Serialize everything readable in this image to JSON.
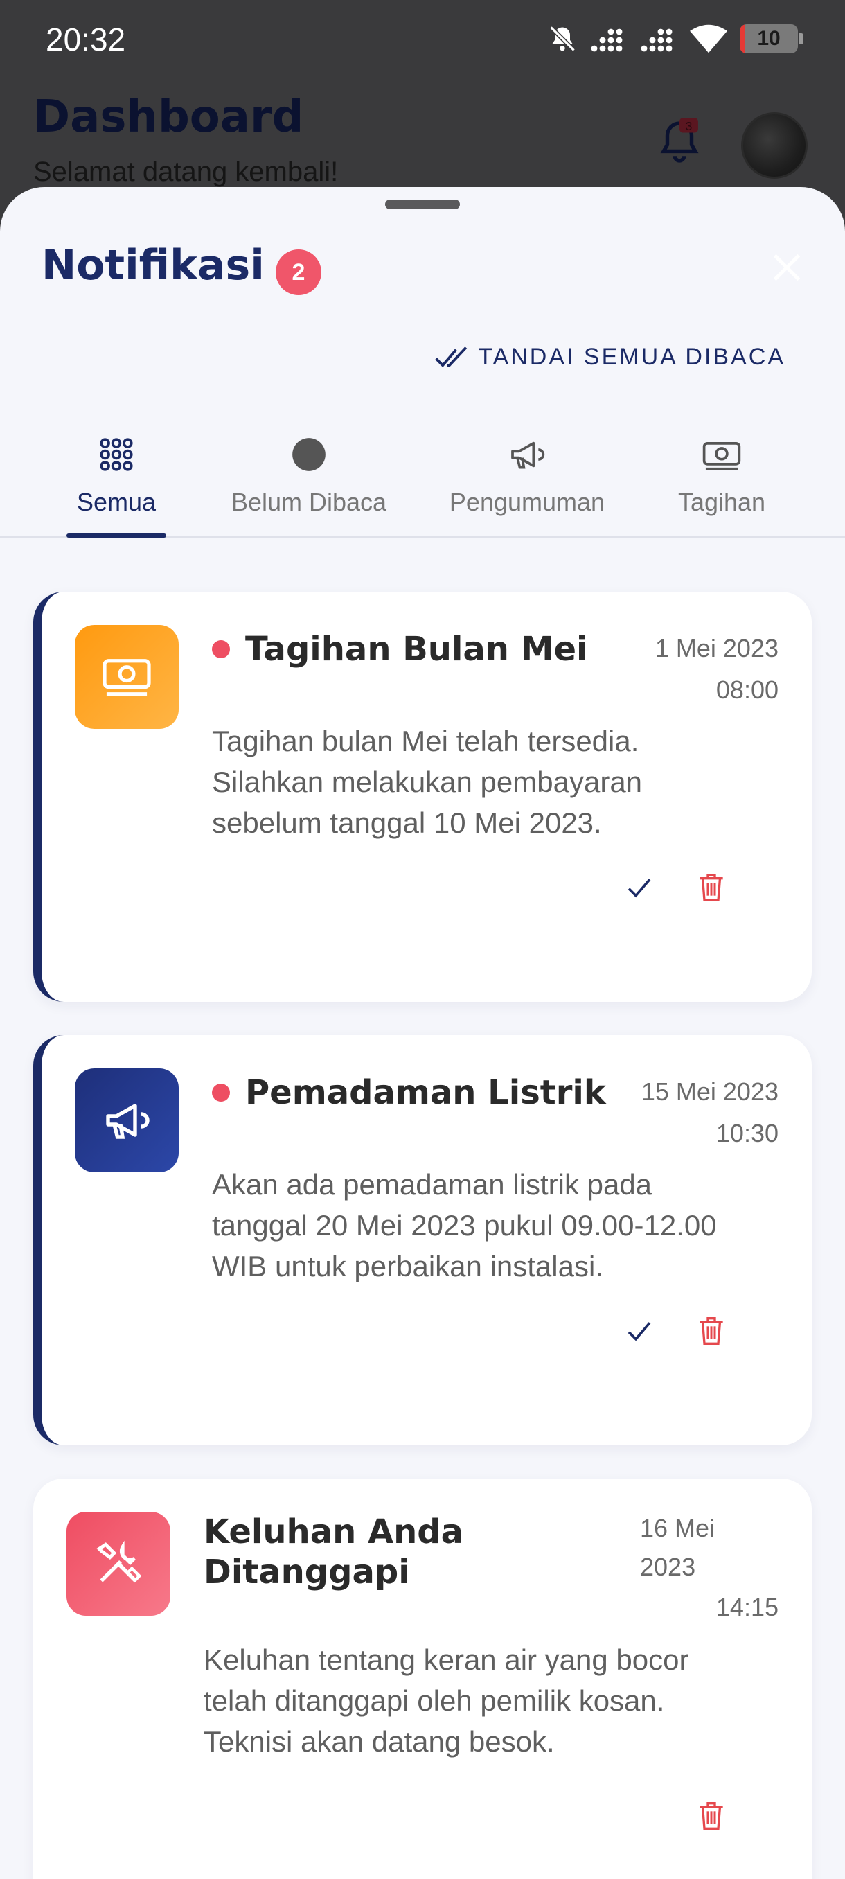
{
  "status_bar": {
    "time": "20:32",
    "battery": "10",
    "battery_level": 0.1
  },
  "dashboard": {
    "title": "Dashboard",
    "subtitle": "Selamat datang kembali!",
    "bell_badge": "3"
  },
  "sheet": {
    "title": "Notifikasi",
    "unread_count": "2",
    "mark_all_label": "TANDAI SEMUA DIBACA"
  },
  "tabs": [
    {
      "label": "Semua",
      "icon": "grid-icon",
      "active": true
    },
    {
      "label": "Belum Dibaca",
      "icon": "dot-icon",
      "active": false
    },
    {
      "label": "Pengumuman",
      "icon": "megaphone-icon",
      "active": false
    },
    {
      "label": "Tagihan",
      "icon": "money-icon",
      "active": false
    }
  ],
  "notifications": [
    {
      "title": "Tagihan Bulan Mei",
      "date": "1 Mei 2023",
      "time": "08:00",
      "body": [
        "Tagihan bulan Mei telah tersedia.",
        "Silahkan melakukan pembayaran",
        "sebelum tanggal 10 Mei 2023."
      ],
      "unread": true,
      "icon": "money-icon",
      "icon_color": "#ffa21f"
    },
    {
      "title": "Pemadaman Listrik",
      "date": "15 Mei 2023",
      "time": "10:30",
      "body": [
        "Akan ada pemadaman listrik pada",
        "tanggal 20 Mei 2023 pukul 09.00-12.00",
        "WIB untuk perbaikan instalasi."
      ],
      "unread": true,
      "icon": "megaphone-icon",
      "icon_color": "#23388f"
    },
    {
      "title_lines": [
        "Keluhan Anda",
        "Ditanggapi"
      ],
      "date_lines": [
        "16 Mei",
        "2023"
      ],
      "time": "14:15",
      "body": [
        "Keluhan tentang keran air yang bocor",
        "telah ditanggapi oleh pemilik kosan.",
        "Teknisi akan datang besok."
      ],
      "unread": false,
      "icon": "tools-icon",
      "icon_color": "#f0566a"
    }
  ],
  "colors": {
    "primary": "#1b2a66",
    "danger": "#e5484d",
    "unread_dot": "#ee4e62"
  }
}
